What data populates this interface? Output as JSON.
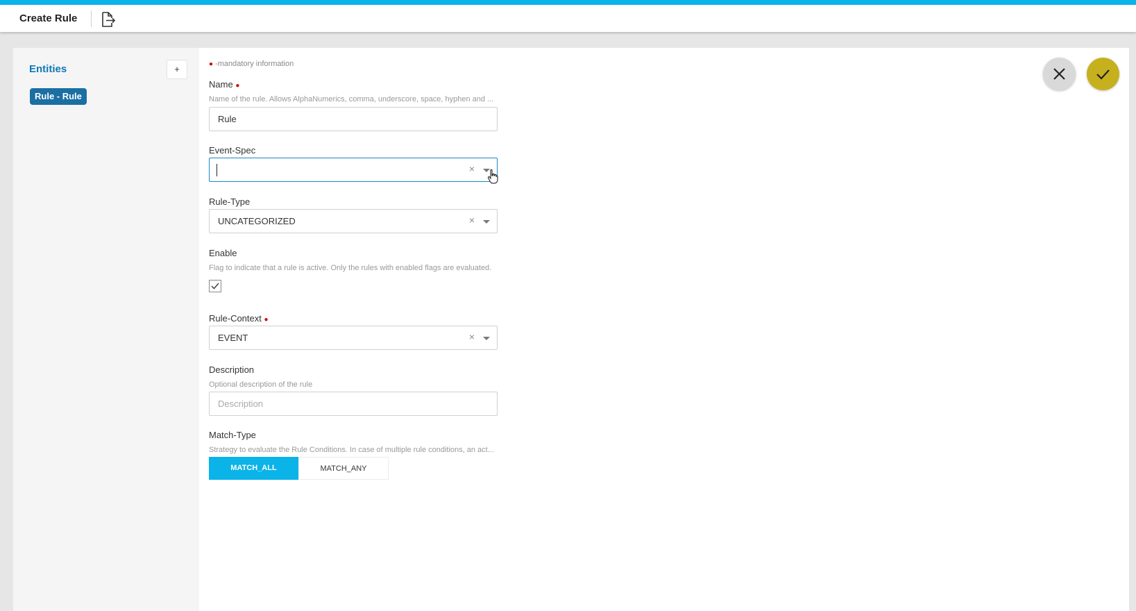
{
  "header": {
    "title": "Create Rule",
    "export_icon": "file-export-icon"
  },
  "sidebar": {
    "title": "Entities",
    "add_label": "+",
    "entities": [
      {
        "label": "Rule - Rule",
        "selected": true
      }
    ]
  },
  "form": {
    "mandatory_note": "-mandatory information",
    "name": {
      "label": "Name",
      "required": true,
      "hint": "Name of the rule. Allows AlphaNumerics, comma, underscore, space, hyphen and ...",
      "value": "Rule"
    },
    "event_spec": {
      "label": "Event-Spec",
      "value": "",
      "focused": true,
      "clear": "×"
    },
    "rule_type": {
      "label": "Rule-Type",
      "value": "UNCATEGORIZED",
      "clear": "×"
    },
    "enable": {
      "label": "Enable",
      "hint": "Flag to indicate that a rule is active. Only the rules with enabled flags are evaluated.",
      "checked": true
    },
    "rule_context": {
      "label": "Rule-Context",
      "required": true,
      "value": "EVENT",
      "clear": "×"
    },
    "description": {
      "label": "Description",
      "hint": "Optional description of the rule",
      "placeholder": "Description",
      "value": ""
    },
    "match_type": {
      "label": "Match-Type",
      "hint": "Strategy to evaluate the Rule Conditions. In case of multiple rule conditions, an act...",
      "options": [
        "MATCH_ALL",
        "MATCH_ANY"
      ],
      "selected": "MATCH_ALL"
    }
  },
  "actions": {
    "cancel_icon": "close-icon",
    "confirm_icon": "check-icon"
  },
  "colors": {
    "accent": "#0ab3e8",
    "entity_chip": "#1a6fa3",
    "confirm": "#c6b01d",
    "required_dot": "#d50000"
  }
}
